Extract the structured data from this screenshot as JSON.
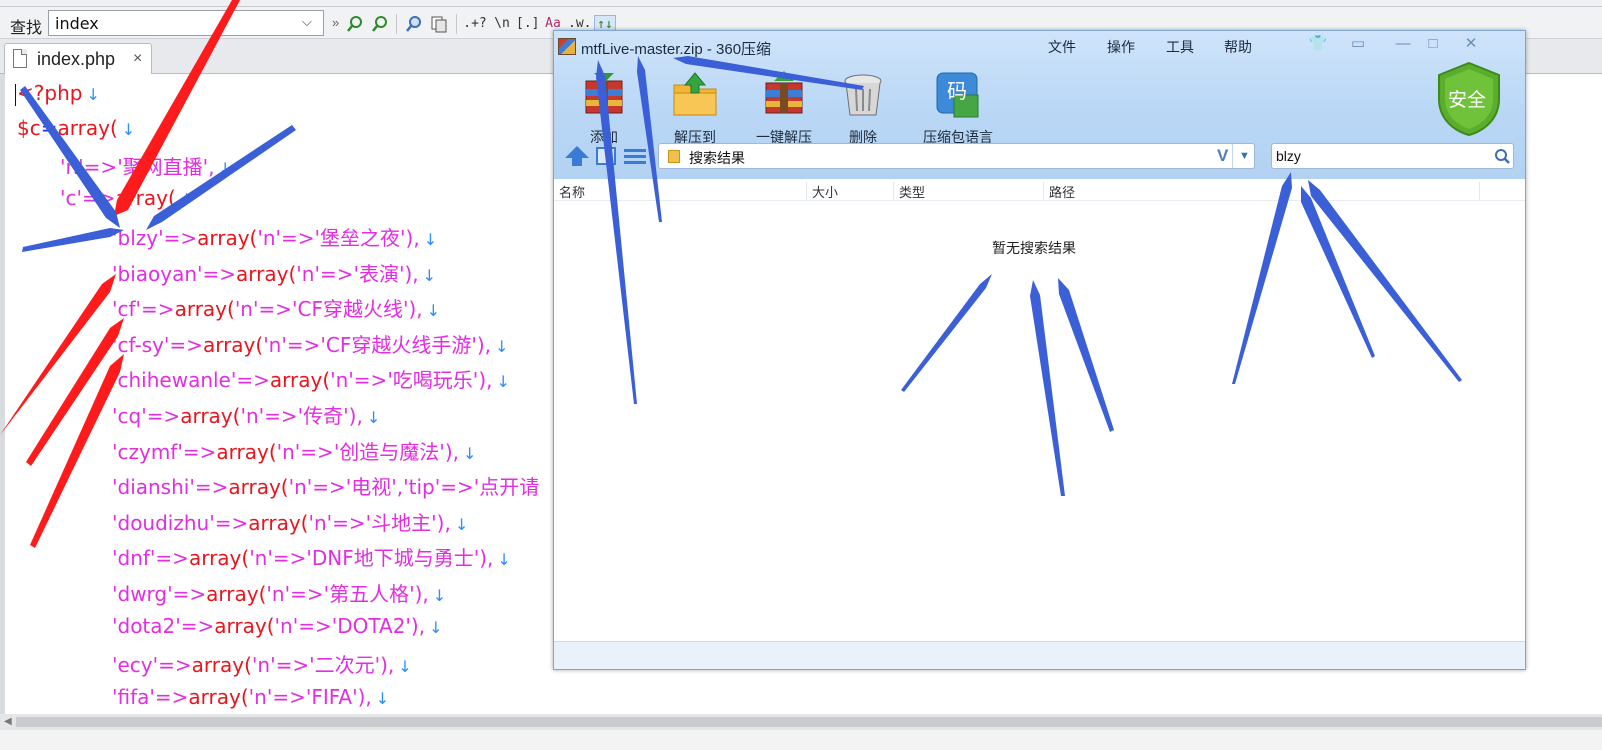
{
  "findbar": {
    "label": "查找",
    "query": "index",
    "more": "»",
    "tools": [
      ".+?",
      "\\n",
      "[.]",
      "Aa",
      ".w.",
      "↑↓"
    ]
  },
  "tab": {
    "label": "index.php",
    "close": "×"
  },
  "code": {
    "line1": {
      "open": "<?php"
    },
    "line2": {
      "var": "$c",
      "eq": "=",
      "fn": "array("
    },
    "line3": {
      "key": "'n'",
      "arrow": "=>",
      "val": "'聚网直播'",
      "tail": ","
    },
    "line4": {
      "key": "'c'",
      "arrow": "=>",
      "fn": "array("
    },
    "items": [
      {
        "key": "'blzy'",
        "name": "'堡垒之夜'"
      },
      {
        "key": "'biaoyan'",
        "name": "'表演'"
      },
      {
        "key": "'cf'",
        "name": "'CF穿越火线'"
      },
      {
        "key": "'cf-sy'",
        "name": "'CF穿越火线手游'"
      },
      {
        "key": "'chihewanle'",
        "name": "'吃喝玩乐'"
      },
      {
        "key": "'cq'",
        "name": "'传奇'"
      },
      {
        "key": "'czymf'",
        "name": "'创造与魔法'"
      },
      {
        "key": "'dianshi'",
        "name": "'电视'",
        "extra_key": "'tip'",
        "extra_val": "'点开请"
      },
      {
        "key": "'doudizhu'",
        "name": "'斗地主'"
      },
      {
        "key": "'dnf'",
        "name": "'DNF地下城与勇士'"
      },
      {
        "key": "'dwrg'",
        "name": "'第五人格'"
      },
      {
        "key": "'dota2'",
        "name": "'DOTA2'"
      },
      {
        "key": "'ecy'",
        "name": "'二次元'"
      },
      {
        "key": "'fifa'",
        "name": "'FIFA'"
      }
    ],
    "arr_word": "array(",
    "n_key": "'n'",
    "arrow": "=>",
    "close": "),",
    "comma": ",",
    "newline_mark": "↓"
  },
  "window": {
    "title": "mtfLive-master.zip - 360压缩",
    "menu": [
      "文件",
      "操作",
      "工具",
      "帮助"
    ],
    "controls": [
      "👕",
      "▭",
      "—",
      "□",
      "✕"
    ],
    "toolbar": [
      "添加",
      "解压到",
      "一键解压",
      "删除",
      "压缩包语言"
    ],
    "shield_label": "安全",
    "path": {
      "text": "搜索结果",
      "v": "V",
      "dd": "▼"
    },
    "search": {
      "value": "blzy"
    },
    "columns": [
      "名称",
      "大小",
      "类型",
      "路径"
    ],
    "empty_message": "暂无搜索结果"
  },
  "icons": {
    "add_zip_text": "码",
    "colors": {
      "red_arrow": "#ff1b1b",
      "blue_arrow": "#3b5fd6",
      "keyword": "#e8151e",
      "string": "#e22ee0"
    }
  }
}
